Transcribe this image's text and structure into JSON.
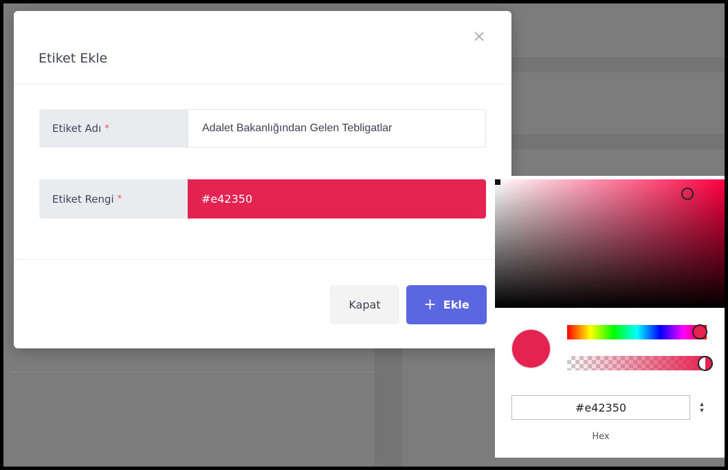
{
  "modal": {
    "title": "Etiket Ekle",
    "close_icon": "close-icon",
    "fields": {
      "name": {
        "label": "Etiket Adı",
        "required_mark": "*",
        "value": "Adalet Bakanlığından Gelen Tebligatlar"
      },
      "color": {
        "label": "Etiket Rengi",
        "required_mark": "*",
        "value": "#e42350"
      }
    },
    "buttons": {
      "close_label": "Kapat",
      "add_icon": "plus-icon",
      "add_label": "Ekle"
    }
  },
  "color_picker": {
    "selected_color": "#e42350",
    "hex_value": "#e42350",
    "mode_label": "Hex",
    "mode_toggle_icon": "up-down-arrows-icon"
  },
  "colors": {
    "accent": "#e42350",
    "primary_button": "#5a67e0",
    "required": "#f64e60",
    "overlay": "#7c7c7c"
  }
}
